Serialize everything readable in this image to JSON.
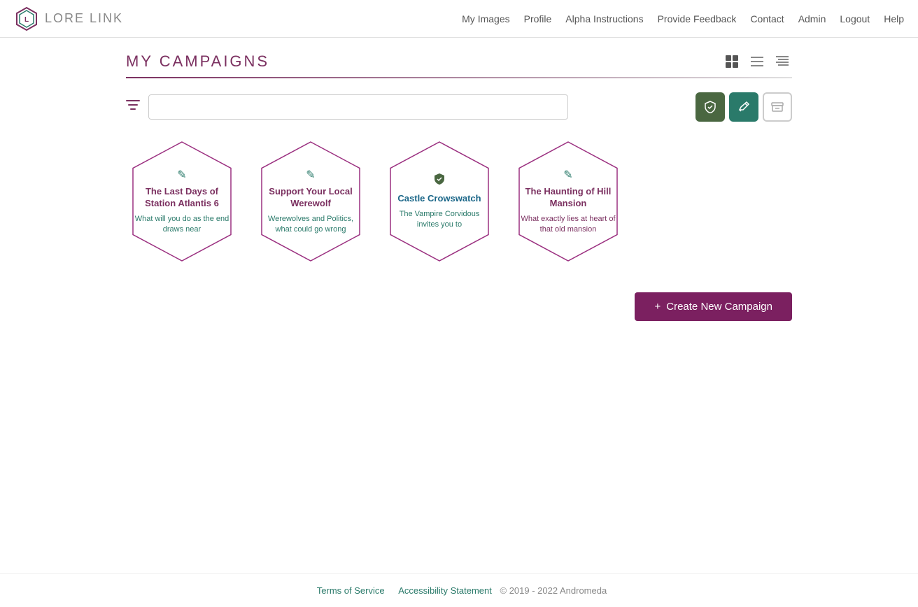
{
  "nav": {
    "logo_text": "LORE LINK",
    "links": [
      {
        "label": "My Images",
        "name": "my-images"
      },
      {
        "label": "Profile",
        "name": "profile"
      },
      {
        "label": "Alpha Instructions",
        "name": "alpha-instructions"
      },
      {
        "label": "Provide Feedback",
        "name": "provide-feedback"
      },
      {
        "label": "Contact",
        "name": "contact"
      },
      {
        "label": "Admin",
        "name": "admin"
      },
      {
        "label": "Logout",
        "name": "logout"
      },
      {
        "label": "Help",
        "name": "help"
      }
    ]
  },
  "page": {
    "title": "My Campaigns",
    "divider": true
  },
  "filter": {
    "search_placeholder": "",
    "status_buttons": [
      {
        "label": "✓",
        "color": "green",
        "title": "Published",
        "name": "published-filter"
      },
      {
        "label": "✎",
        "color": "teal",
        "title": "Draft",
        "name": "draft-filter"
      },
      {
        "label": "▭",
        "color": "gray",
        "title": "Archived",
        "name": "archived-filter"
      }
    ]
  },
  "campaigns": [
    {
      "title": "The Last Days of Station Atlantis 6",
      "description": "What will you do as the end draws near",
      "icon": "✎",
      "icon_color": "teal",
      "title_color": "purple",
      "desc_color": "teal",
      "name": "campaign-station-atlantis"
    },
    {
      "title": "Support Your Local Werewolf",
      "description": "Werewolves and Politics, what could go wrong",
      "icon": "✎",
      "icon_color": "teal",
      "title_color": "purple",
      "desc_color": "teal",
      "name": "campaign-support-werewolf"
    },
    {
      "title": "Castle Crowswatch",
      "description": "The Vampire Corvidous invites you to",
      "icon": "✓",
      "icon_color": "green",
      "title_color": "blue",
      "desc_color": "teal",
      "name": "campaign-castle-crowswatch"
    },
    {
      "title": "The Haunting of Hill Mansion",
      "description": "What exactly lies at heart of that old mansion",
      "icon": "✎",
      "icon_color": "teal",
      "title_color": "purple",
      "desc_color": "purple",
      "name": "campaign-haunting-hill-mansion"
    }
  ],
  "create_button": {
    "label": "Create New Campaign",
    "icon": "+"
  },
  "footer": {
    "terms": "Terms of Service",
    "accessibility": "Accessibility Statement",
    "copyright": "© 2019 - 2022 Andromeda"
  }
}
